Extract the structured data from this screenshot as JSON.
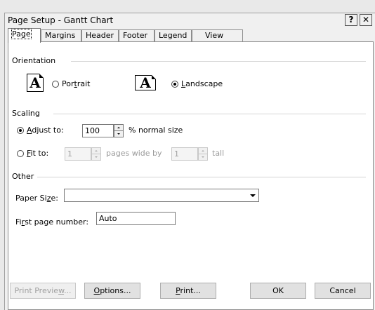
{
  "window": {
    "title": "Page Setup - Gantt Chart",
    "help_glyph": "?",
    "close_glyph": "✕"
  },
  "tabs": [
    {
      "label": "Page",
      "active": true
    },
    {
      "label": "Margins"
    },
    {
      "label": "Header"
    },
    {
      "label": "Footer"
    },
    {
      "label": "Legend"
    },
    {
      "label": "View"
    }
  ],
  "orientation": {
    "header": "Orientation",
    "glyph": "A",
    "portrait": {
      "pre": "Por",
      "key": "t",
      "post": "rait",
      "selected": false
    },
    "landscape": {
      "key": "L",
      "post": "andscape",
      "selected": true
    }
  },
  "scaling": {
    "header": "Scaling",
    "adjust": {
      "key": "A",
      "post": "djust to:",
      "value": "100",
      "suffix": "% normal size",
      "selected": true
    },
    "fit": {
      "key": "F",
      "post": "it to:",
      "wide_value": "1",
      "wide_suffix": "pages wide by",
      "tall_value": "1",
      "tall_suffix": "tall",
      "selected": false
    }
  },
  "other": {
    "header": "Other",
    "paper_size": {
      "pre": "Paper Si",
      "key": "z",
      "post": "e:",
      "value": ""
    },
    "first_page": {
      "pre": "Fi",
      "key": "r",
      "post": "st page number:",
      "value": "Auto"
    }
  },
  "buttons": {
    "preview": {
      "pre": "Print Previe",
      "key": "w",
      "post": "..."
    },
    "options": {
      "key": "O",
      "post": "ptions..."
    },
    "print": {
      "key": "P",
      "post": "rint..."
    },
    "ok": "OK",
    "cancel": "Cancel"
  }
}
